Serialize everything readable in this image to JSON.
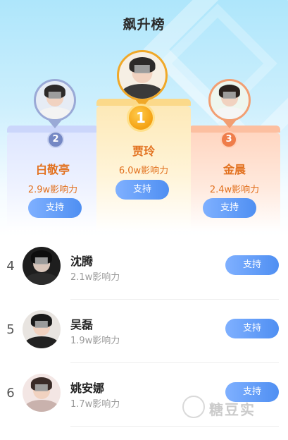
{
  "header": {
    "title": "飙升榜"
  },
  "top3": [
    {
      "rank": "1",
      "name": "贾玲",
      "score": "6.0w影响力",
      "button": "支持"
    },
    {
      "rank": "2",
      "name": "白敬亭",
      "score": "2.9w影响力",
      "button": "支持"
    },
    {
      "rank": "3",
      "name": "金晨",
      "score": "2.4w影响力",
      "button": "支持"
    }
  ],
  "list": [
    {
      "rank": "4",
      "name": "沈腾",
      "score": "2.1w影响力",
      "button": "支持"
    },
    {
      "rank": "5",
      "name": "吴磊",
      "score": "1.9w影响力",
      "button": "支持"
    },
    {
      "rank": "6",
      "name": "姚安娜",
      "score": "1.7w影响力",
      "button": "支持"
    }
  ],
  "watermark": {
    "text": "糖豆实"
  },
  "colors": {
    "accent_blue": "#4f8ff2",
    "name_orange": "#e2711f",
    "gold": "#f4a113",
    "silver": "#7588c4",
    "bronze": "#ef7d4a"
  }
}
